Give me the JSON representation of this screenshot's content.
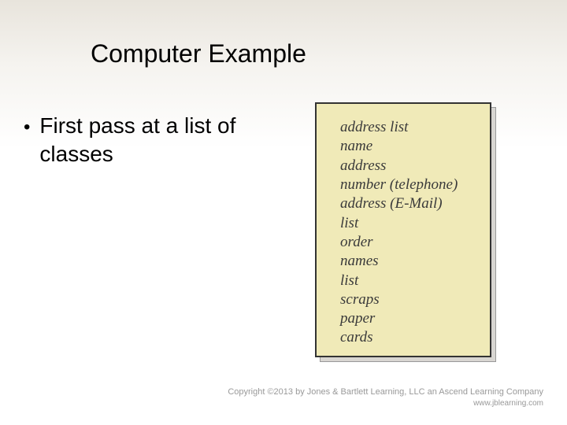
{
  "title": "Computer Example",
  "bullet": {
    "text": "First pass at a list of classes"
  },
  "note_items": [
    "address list",
    "name",
    "address",
    "number (telephone)",
    "address (E-Mail)",
    "list",
    "order",
    "names",
    "list",
    "scraps",
    "paper",
    "cards"
  ],
  "footer": {
    "line1": "Copyright ©2013 by Jones & Bartlett Learning, LLC an Ascend Learning Company",
    "line2": "www.jblearning.com"
  }
}
